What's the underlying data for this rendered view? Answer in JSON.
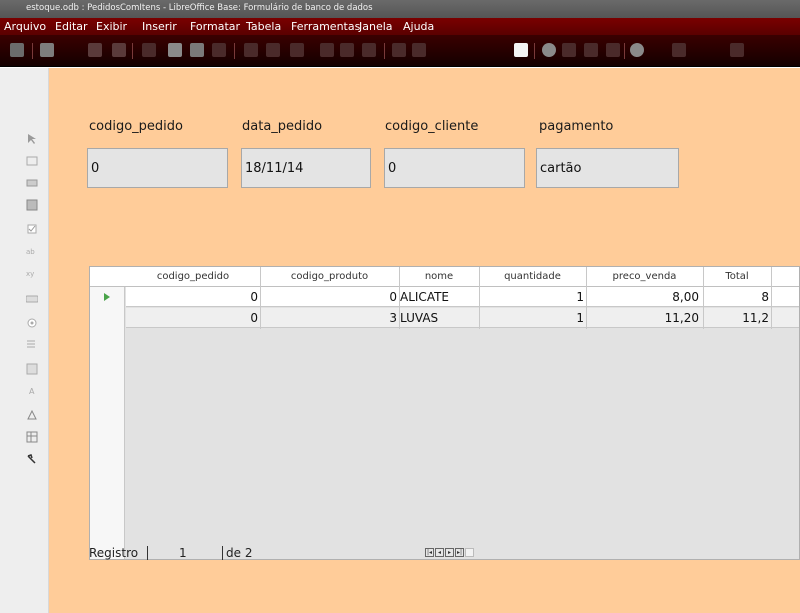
{
  "window": {
    "title": "estoque.odb : PedidosComItens - LibreOffice Base: Formulário de banco de dados"
  },
  "menu": {
    "items": [
      "Arquivo",
      "Editar",
      "Exibir",
      "Inserir",
      "Formatar",
      "Tabela",
      "Ferramentas",
      "Janela",
      "Ajuda"
    ]
  },
  "toolbar": {
    "icons": [
      "toggle-design-icon",
      "open-icon",
      "save-icon",
      "edit-icon",
      "pdf-icon",
      "print-icon",
      "preview-icon",
      "spelling-icon",
      "cut-icon",
      "copy-icon",
      "paste-icon",
      "format-paint-icon",
      "undo-icon",
      "redo-icon",
      "hyperlink-icon",
      "table-icon",
      "controls-icon",
      "navigator-icon",
      "gallery-icon",
      "datasources-icon",
      "formatting-marks-icon",
      "help-icon",
      "zoom-icon",
      "image-icon"
    ]
  },
  "sidebar": {
    "icons": [
      "select-icon",
      "label-icon",
      "textbox-icon",
      "form-icon",
      "checkbox-icon",
      "option-icon",
      "spin-icon",
      "push-button-icon",
      "radio-icon",
      "list-icon",
      "combo-icon",
      "text-icon",
      "wizard-icon",
      "grid-icon",
      "builder-icon"
    ]
  },
  "form": {
    "fields": [
      {
        "label": "codigo_pedido",
        "value": "0"
      },
      {
        "label": "data_pedido",
        "value": "18/11/14"
      },
      {
        "label": "codigo_cliente",
        "value": "0"
      },
      {
        "label": "pagamento",
        "value": "cartão"
      }
    ]
  },
  "grid": {
    "columns": [
      "codigo_pedido",
      "codigo_produto",
      "nome",
      "quantidade",
      "preco_venda",
      "Total"
    ],
    "rows": [
      {
        "codigo_pedido": "0",
        "codigo_produto": "0",
        "nome": "ALICATE",
        "quantidade": "1",
        "preco_venda": "8,00",
        "total": "8"
      },
      {
        "codigo_pedido": "0",
        "codigo_produto": "3",
        "nome": "LUVAS",
        "quantidade": "1",
        "preco_venda": "11,20",
        "total": "11,2"
      }
    ]
  },
  "navigation": {
    "record_label": "Registro",
    "record_number": "1",
    "of_label": "de 2"
  },
  "colors": {
    "form_background": "#ffcc99",
    "menubar": "#6a0000",
    "row_marker": "#49a349"
  }
}
